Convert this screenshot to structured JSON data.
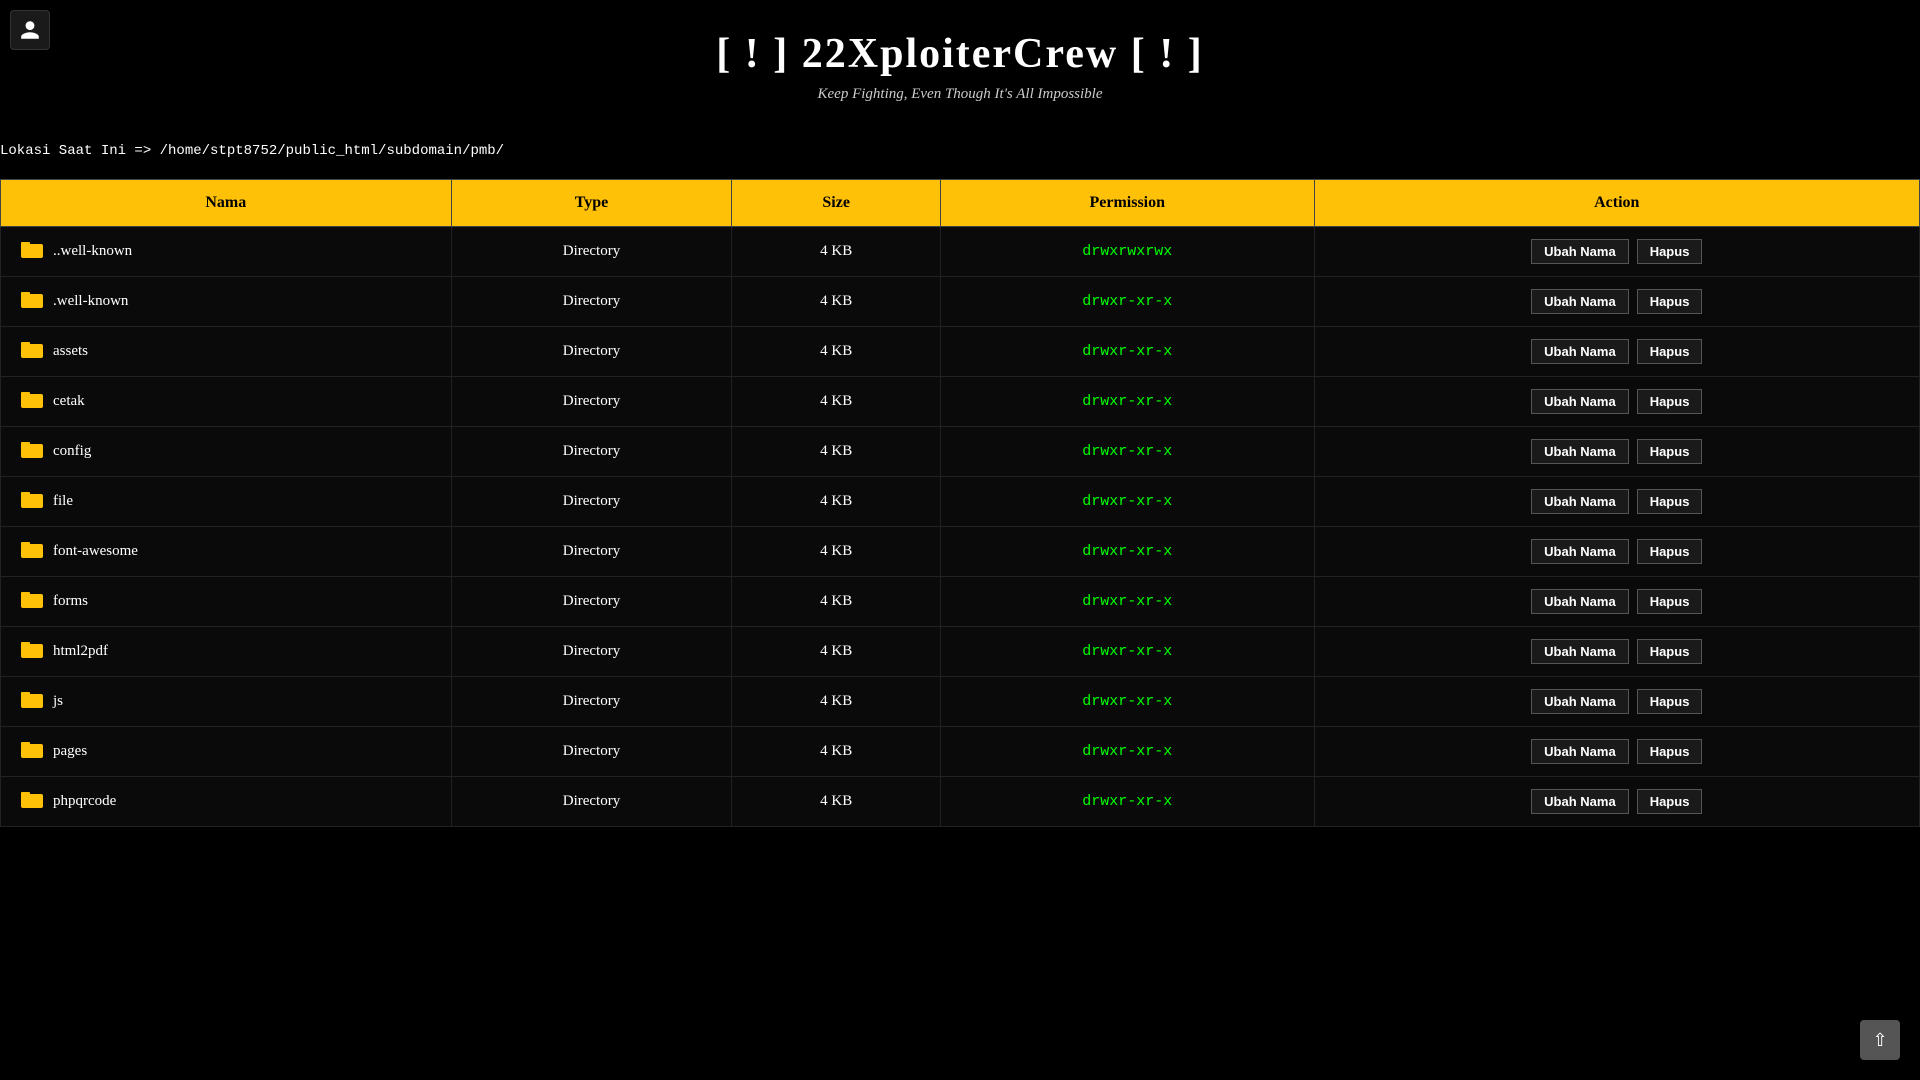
{
  "header": {
    "title": "[ ! ] 22XploiterCrew [ ! ]",
    "subtitle": "Keep Fighting, Even Though It's All Impossible"
  },
  "location": {
    "label": "Lokasi Saat Ini => /home/stpt8752/public_html/subdomain/pmb/"
  },
  "table": {
    "columns": {
      "nama": "Nama",
      "type": "Type",
      "size": "Size",
      "permission": "Permission",
      "action": "Action"
    },
    "btn_ubah": "Ubah Nama",
    "btn_hapus": "Hapus",
    "rows": [
      {
        "name": "..well-known",
        "type": "Directory",
        "size": "4 KB",
        "permission": "drwxrwxrwx"
      },
      {
        "name": ".well-known",
        "type": "Directory",
        "size": "4 KB",
        "permission": "drwxr-xr-x"
      },
      {
        "name": "assets",
        "type": "Directory",
        "size": "4 KB",
        "permission": "drwxr-xr-x"
      },
      {
        "name": "cetak",
        "type": "Directory",
        "size": "4 KB",
        "permission": "drwxr-xr-x"
      },
      {
        "name": "config",
        "type": "Directory",
        "size": "4 KB",
        "permission": "drwxr-xr-x"
      },
      {
        "name": "file",
        "type": "Directory",
        "size": "4 KB",
        "permission": "drwxr-xr-x"
      },
      {
        "name": "font-awesome",
        "type": "Directory",
        "size": "4 KB",
        "permission": "drwxr-xr-x"
      },
      {
        "name": "forms",
        "type": "Directory",
        "size": "4 KB",
        "permission": "drwxr-xr-x"
      },
      {
        "name": "html2pdf",
        "type": "Directory",
        "size": "4 KB",
        "permission": "drwxr-xr-x"
      },
      {
        "name": "js",
        "type": "Directory",
        "size": "4 KB",
        "permission": "drwxr-xr-x"
      },
      {
        "name": "pages",
        "type": "Directory",
        "size": "4 KB",
        "permission": "drwxr-xr-x"
      },
      {
        "name": "phpqrcode",
        "type": "Directory",
        "size": "4 KB",
        "permission": "drwxr-xr-x"
      }
    ]
  },
  "colors": {
    "header_bg": "#FFC107",
    "permission_color": "#00ff00",
    "folder_color": "#FFC107"
  }
}
